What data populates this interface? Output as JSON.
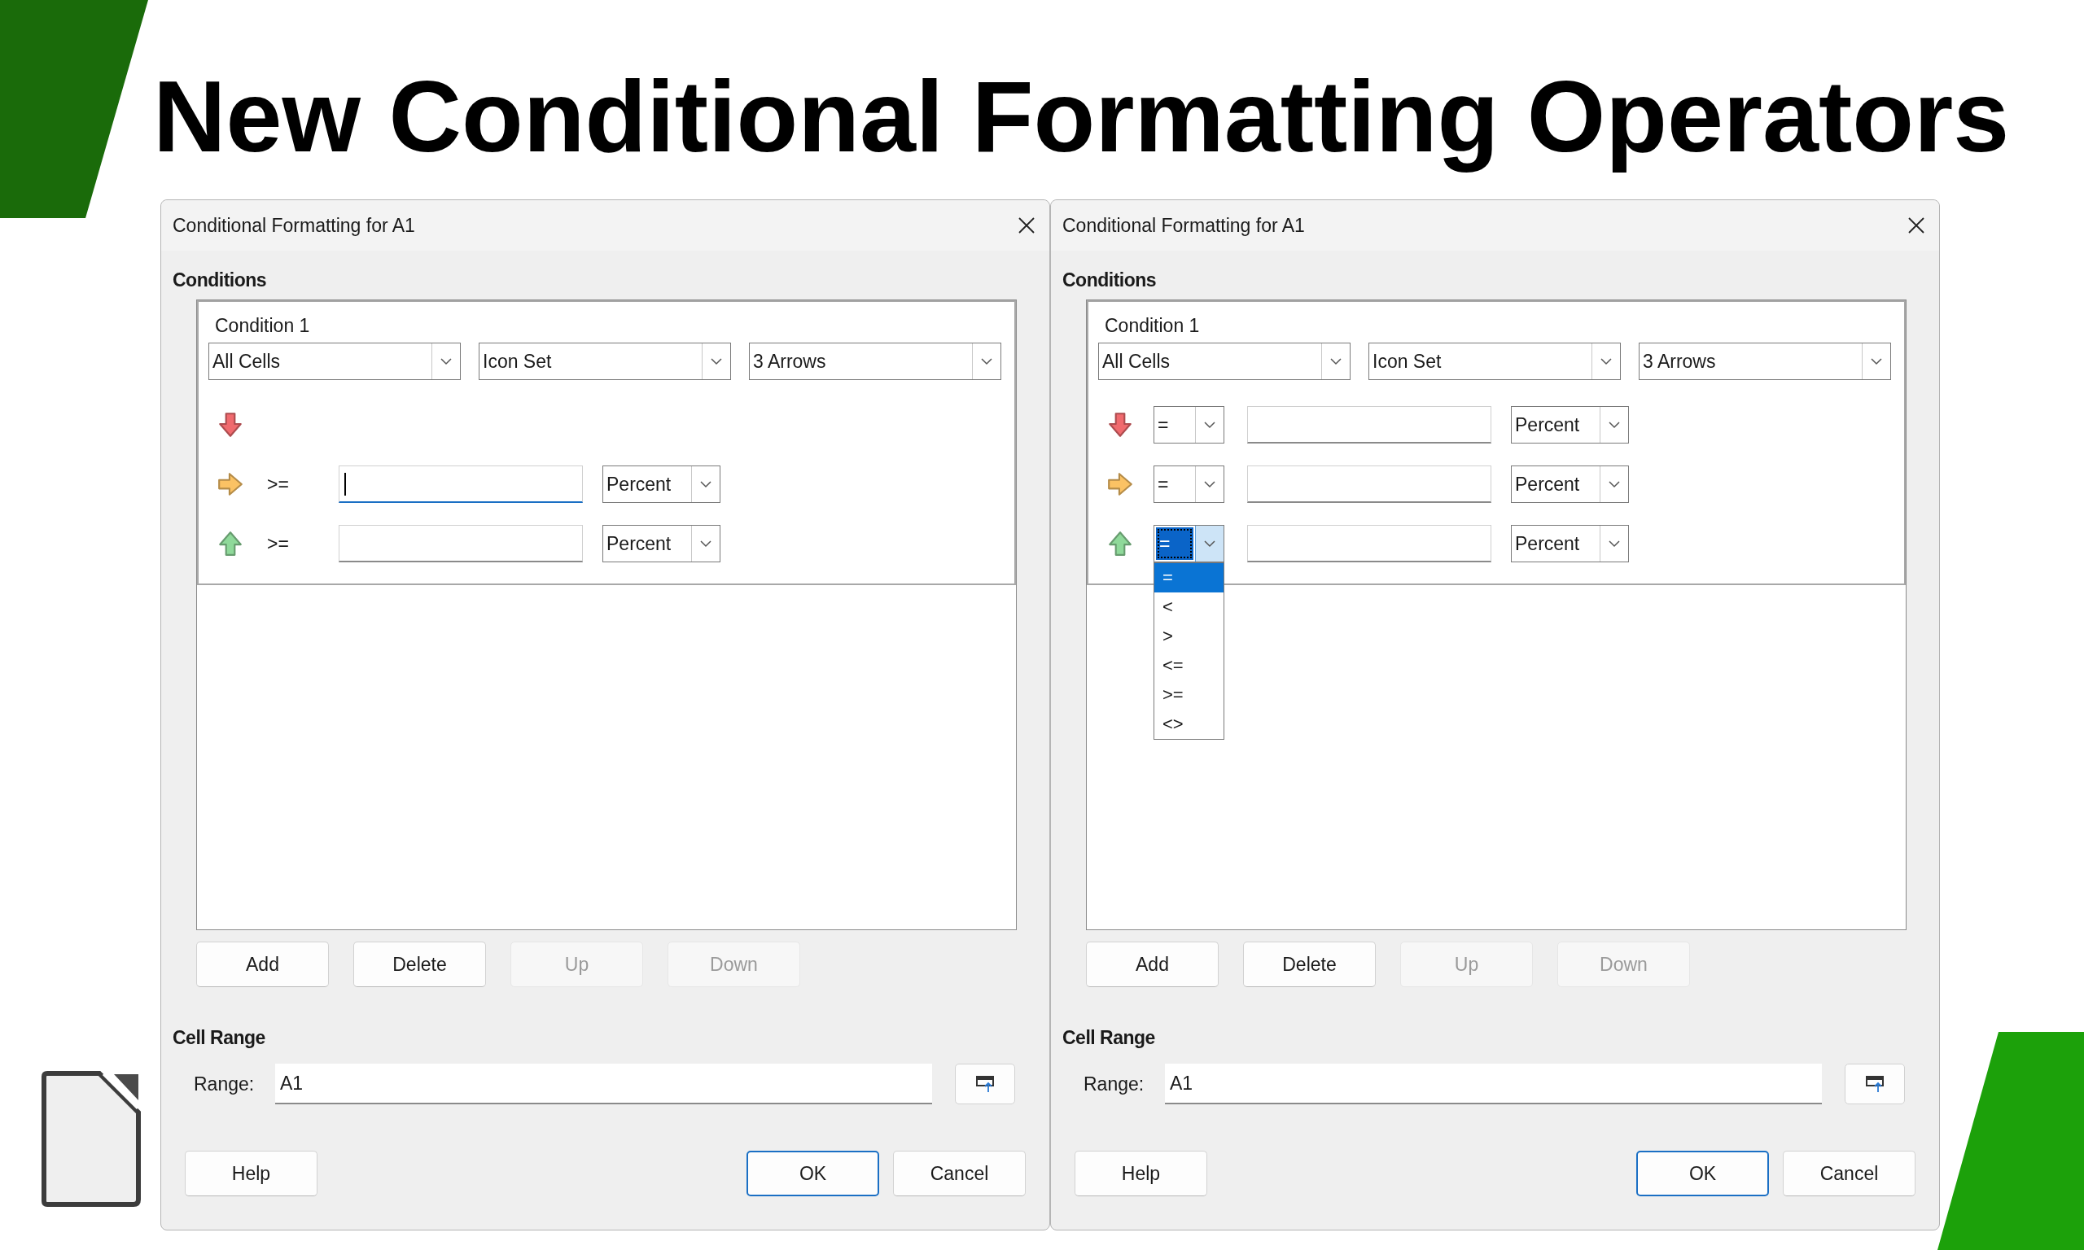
{
  "slide": {
    "title": "New Conditional Formatting Operators"
  },
  "dialogs": [
    {
      "title": "Conditional Formatting for A1",
      "conditions_heading": "Conditions",
      "condition": {
        "label": "Condition 1",
        "selectors": [
          "All Cells",
          "Icon Set",
          "3 Arrows"
        ],
        "rows": [
          {
            "kind": "icon_only",
            "icon": {
              "kind": "arrow_down",
              "color": "#f06a6e"
            }
          },
          {
            "kind": "static_operator",
            "icon": {
              "kind": "arrow_right",
              "color": "#fbc264"
            },
            "operator": ">=",
            "focused": true,
            "unit": "Percent"
          },
          {
            "kind": "static_operator",
            "icon": {
              "kind": "arrow_up",
              "color": "#8fd99a"
            },
            "operator": ">=",
            "focused": false,
            "unit": "Percent"
          }
        ]
      },
      "buttons": [
        {
          "label": "Add",
          "disabled": false
        },
        {
          "label": "Delete",
          "disabled": false
        },
        {
          "label": "Up",
          "disabled": true
        },
        {
          "label": "Down",
          "disabled": true
        }
      ],
      "range_heading": "Cell Range",
      "range_label": "Range:",
      "range_value": "A1",
      "footer": [
        {
          "label": "Help",
          "default": false
        },
        {
          "label": "OK",
          "default": true
        },
        {
          "label": "Cancel",
          "default": false
        }
      ]
    },
    {
      "title": "Conditional Formatting for A1",
      "conditions_heading": "Conditions",
      "condition": {
        "label": "Condition 1",
        "selectors": [
          "All Cells",
          "Icon Set",
          "3 Arrows"
        ],
        "rows": [
          {
            "kind": "operator_dropdown",
            "icon": {
              "kind": "arrow_down",
              "color": "#f06a6e"
            },
            "operator": "=",
            "open": false,
            "focused": false,
            "unit": "Percent"
          },
          {
            "kind": "operator_dropdown",
            "icon": {
              "kind": "arrow_right",
              "color": "#fbc264"
            },
            "operator": "=",
            "open": false,
            "focused": false,
            "unit": "Percent"
          },
          {
            "kind": "operator_dropdown",
            "icon": {
              "kind": "arrow_up",
              "color": "#8fd99a"
            },
            "operator": "=",
            "open": true,
            "focused": false,
            "unit": "Percent",
            "options": [
              {
                "label": "=",
                "selected": true
              },
              {
                "label": "<",
                "selected": false
              },
              {
                "label": ">",
                "selected": false
              },
              {
                "label": "<=",
                "selected": false
              },
              {
                "label": ">=",
                "selected": false
              },
              {
                "label": "<>",
                "selected": false
              }
            ]
          }
        ]
      },
      "buttons": [
        {
          "label": "Add",
          "disabled": false
        },
        {
          "label": "Delete",
          "disabled": false
        },
        {
          "label": "Up",
          "disabled": true
        },
        {
          "label": "Down",
          "disabled": true
        }
      ],
      "range_heading": "Cell Range",
      "range_label": "Range:",
      "range_value": "A1",
      "footer": [
        {
          "label": "Help",
          "default": false
        },
        {
          "label": "OK",
          "default": true
        },
        {
          "label": "Cancel",
          "default": false
        }
      ]
    }
  ]
}
